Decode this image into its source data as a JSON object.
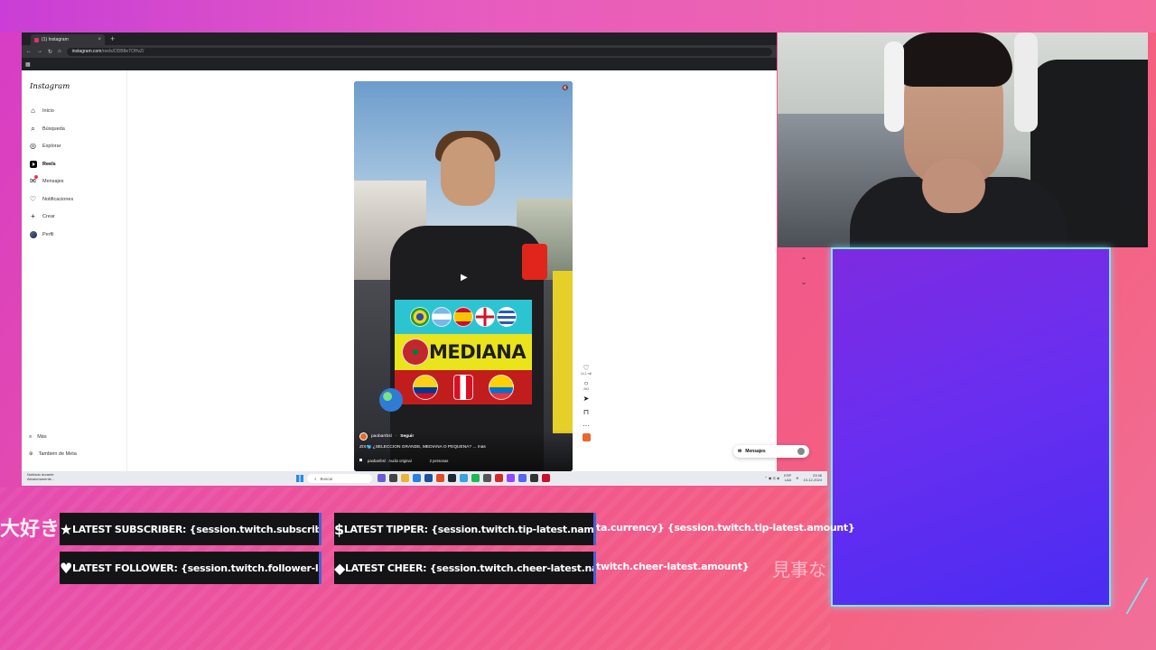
{
  "overlay": {
    "accent_cyan": "#7fe7f0",
    "panel_purple": "#6a2ef0",
    "jp_left": "大好き",
    "jp_right": "見事な"
  },
  "browser": {
    "tab_title": "(1) Instagram",
    "tab_close": "×",
    "tab_new": "+",
    "url_host": "instagram.com",
    "url_path": "/reels/DDB8e7OHvZ/",
    "back": "←",
    "forward": "→",
    "reload": "↻",
    "home": "⌂",
    "apps_glyph": "▦"
  },
  "sidebar": {
    "logo": "Instagram",
    "items": [
      {
        "label": "Inicio",
        "icon": "home-icon",
        "glyph": "⌂"
      },
      {
        "label": "Búsqueda",
        "icon": "search-icon",
        "glyph": "⌕"
      },
      {
        "label": "Explorar",
        "icon": "compass-icon",
        "glyph": "◎"
      },
      {
        "label": "Reels",
        "icon": "reels-icon",
        "glyph": ""
      },
      {
        "label": "Mensajes",
        "icon": "messenger-icon",
        "glyph": "✉"
      },
      {
        "label": "Notificaciones",
        "icon": "heart-icon",
        "glyph": "♡"
      },
      {
        "label": "Crear",
        "icon": "plus-icon",
        "glyph": "+"
      },
      {
        "label": "Perfil",
        "icon": "avatar-icon",
        "glyph": ""
      }
    ],
    "more": {
      "label": "Más",
      "glyph": "≡"
    },
    "meta": {
      "label": "También de Meta",
      "glyph": "⊛"
    }
  },
  "reel": {
    "username": "paobarrbsl",
    "follow": "Seguir",
    "caption": "ZIX🌎 ¿SELECCIÓN GRANDE, MEDIANA O PEQUEÑA? ... más",
    "audio": "paobarrbsl · Audio original",
    "people": "2 personas",
    "middle_text": "MEDIANA",
    "play_glyph": "▶",
    "mute_glyph": "🔇",
    "likes": "14,1 mil",
    "comments": "263"
  },
  "actions": {
    "like": "♡",
    "comment": "○",
    "share": "➤",
    "save": "⊓",
    "more": "···"
  },
  "nav_arrows": {
    "up": "⌃",
    "down": "⌄"
  },
  "messages_pill": {
    "label": "Mensajes"
  },
  "taskbar": {
    "weather_line1": "Nublado durante",
    "weather_line2": "Aleatoriamente...",
    "search_placeholder": "Buscar",
    "lang_top": "ESP",
    "lang_bottom": "LAA",
    "time": "23:36",
    "date": "10-12-2024"
  },
  "alerts": {
    "subscriber": "LATEST SUBSCRIBER: {session.twitch.subscriber-latest.name}",
    "tipper_head": "LATEST TIPPER: {session.twitch.tip-latest.name} - {event.da",
    "tipper_tail": "ta.currency} {session.twitch.tip-latest.amount}",
    "follower": "LATEST FOLLOWER: {session.twitch.follower-latest.name}",
    "cheer_head": "LATEST CHEER: {session.twitch.cheer-latest.name} - {session.",
    "cheer_tail": "twitch.cheer-latest.amount}",
    "icon_star": "★",
    "icon_dollar": "$",
    "icon_heart": "♥",
    "icon_diamond": "◆"
  }
}
